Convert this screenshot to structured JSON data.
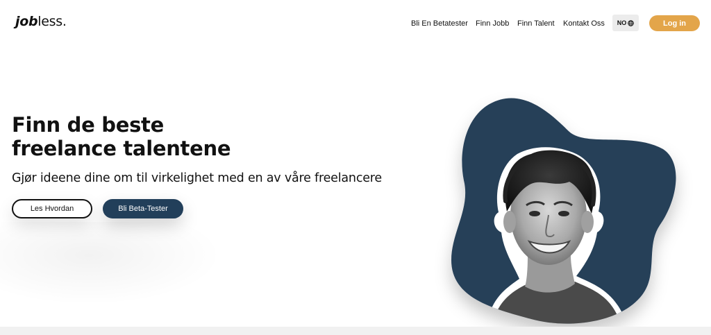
{
  "logo": {
    "bold": "job",
    "light": "less."
  },
  "nav": {
    "items": [
      {
        "label": "Bli En Betatester"
      },
      {
        "label": "Finn Jobb"
      },
      {
        "label": "Finn Talent"
      },
      {
        "label": "Kontakt Oss"
      }
    ],
    "language": "NO",
    "language_icon": "globe-icon",
    "login_label": "Log in"
  },
  "hero": {
    "title_line1": "Finn de beste",
    "title_line2": "freelance talentene",
    "subtitle": "Gjør ideene dine om til virkelighet med en av våre freelancere",
    "primary_button": "Les Hvordan",
    "secondary_button": "Bli Beta-Tester"
  },
  "colors": {
    "accent": "#e3a54a",
    "dark_blue": "#223f5a",
    "blob": "#273f58"
  }
}
